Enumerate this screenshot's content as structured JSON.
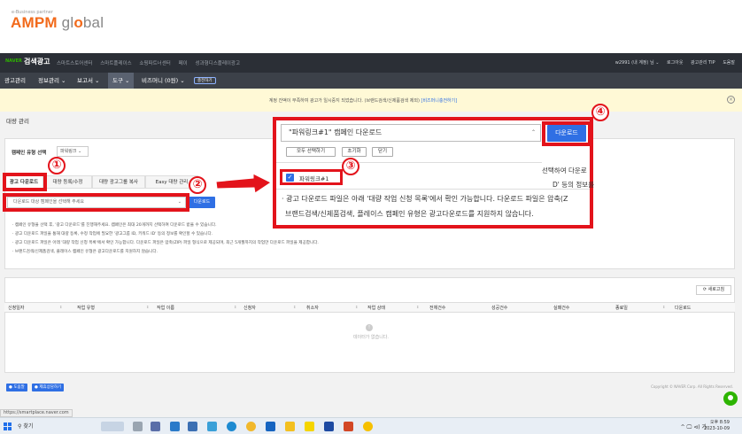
{
  "logo": {
    "tagline": "e-Business partner",
    "brand_a": "AMPM",
    "brand_g": " gl",
    "brand_o": "o",
    "brand_b": "bal"
  },
  "naver_header": {
    "brand": "NAVER",
    "title": "검색광고",
    "links": [
      "스마트스토어센터",
      "스마트플레이스",
      "쇼핑파트너센터",
      "페이",
      "성과형디스플레이광고"
    ],
    "right": [
      "w2991 (내 계정) 님 ⌄",
      "로그아웃",
      "광고관리 TIP",
      "도움말"
    ]
  },
  "nav": {
    "items": [
      "광고관리",
      "정보관리 ⌄",
      "보고서 ⌄",
      "도구 ⌄",
      "비즈머니 (0원) ⌄"
    ],
    "active_index": 3,
    "badge": "충전하기"
  },
  "notice": {
    "text": "계정 잔액이 부족하여 광고가 일시중지 되었습니다. (브랜드검색/신제품검색 제외) ",
    "link": "[비즈머니충전하기]"
  },
  "page_title": "대량 관리",
  "type_label": "캠페인 유형 선택",
  "type_value": "파워링크 ⌄",
  "tabs": [
    "광고 다운로드",
    "대량 등록/수정",
    "대량 광고그룹 복사",
    "Easy 대량 관리"
  ],
  "campaign_select_placeholder": "다운로드 대상 캠페인을 선택해 주세요",
  "download_small": "다운로드",
  "help_lines": [
    "· 캠페인 유형을 선택 후, '광고 다운로드'를 진행해주세요. 캠페인은 최대 20개까지 선택하여 다운로드 받을 수 있습니다.",
    "· 광고 다운로드 파일을 통해 대량 등록, 수정 작업에 필요한 '광고그룹 ID, 키워드 ID' 등의 정보를 확인할 수 있습니다.",
    "· 광고 다운로드 파일은 아래 '대량 작업 신청 목록'에서 확인 가능합니다. 다운로드 파일은 압축(ZIP) 파일 형식으로 제공되며, 최근 5개월까지의 작업만 다운로드 파일을 제공합니다.",
    "· 브랜드검색/신제품검색, 플레이스 캠페인 유형은 광고다운로드를 지원하지 않습니다."
  ],
  "refresh": "⟳ 새로고침",
  "table_headers": [
    "신청일자",
    "작업 유형",
    "작업 이름",
    "신청자",
    "취소자",
    "작업 상태",
    "전체건수",
    "성공건수",
    "실패건수",
    "종료일",
    "다운로드"
  ],
  "empty": "데이터가 없습니다.",
  "bottom_buttons": [
    "도움말",
    "제휴상담하기"
  ],
  "copyright": "Copyright © NAVER Corp. All Rights Reserved.",
  "url": "https://smartplace.naver.com",
  "popup": {
    "title": "\"파워링크#1\" 캠페인 다운로드",
    "buttons": [
      "모두 선택하기",
      "초기화",
      "닫기"
    ],
    "campaign": "파워링크#1",
    "line1": "· 광고 다운로드 파일은 아래 '대량 작업 신청 목록'에서 확인 가능합니다. 다운로드 파일은 압축(Z",
    "line2": "브랜드검색/신제품검색, 플레이스 캠페인 유형은 광고다운로드를 지원하지 않습니다.",
    "right1": "선택하여 다운로",
    "right2": "D' 등의 정보를",
    "download": "다운로드"
  },
  "annotations": [
    "①",
    "②",
    "③",
    "④"
  ],
  "taskbar": {
    "search": "찾기",
    "tray": "^ 🖵 ⊲) 가",
    "time": "오후 8:59",
    "date": "2023-10-09"
  },
  "colors": {
    "accent": "#2f6fe4",
    "annotation": "#e3131b",
    "naver_green": "#2db400"
  }
}
